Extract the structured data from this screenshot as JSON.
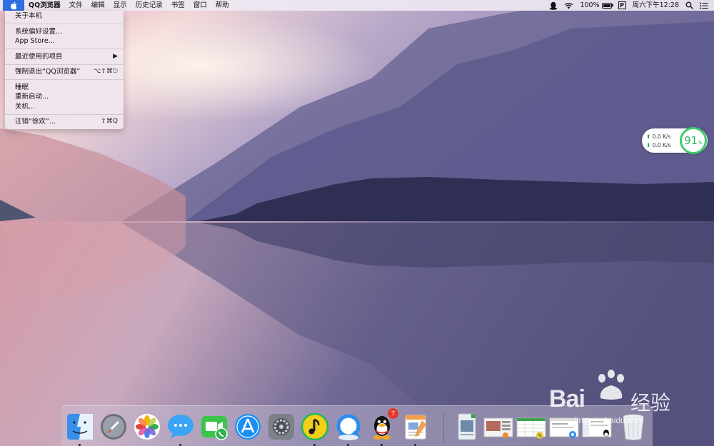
{
  "menubar": {
    "apple_icon": "apple-logo-icon",
    "app_name": "QQ浏览器",
    "menus": [
      "文件",
      "编辑",
      "显示",
      "历史记录",
      "书签",
      "窗口",
      "帮助"
    ],
    "status": {
      "battery_percent": "100%",
      "battery_level": 1.0,
      "input_method": "P",
      "datetime": "周六下午12:28"
    }
  },
  "apple_menu": {
    "groups": [
      [
        {
          "label": "关于本机",
          "shortcut": ""
        }
      ],
      [
        {
          "label": "系统偏好设置...",
          "shortcut": ""
        },
        {
          "label": "App Store...",
          "shortcut": ""
        }
      ],
      [
        {
          "label": "最近使用的项目",
          "shortcut": "▶"
        }
      ],
      [
        {
          "label": "强制退出“QQ浏览器”",
          "shortcut": "⌥⇧⌘⎋"
        }
      ],
      [
        {
          "label": "睡眠",
          "shortcut": ""
        },
        {
          "label": "重新启动...",
          "shortcut": ""
        },
        {
          "label": "关机...",
          "shortcut": ""
        }
      ],
      [
        {
          "label": "注销“徐欢”...",
          "shortcut": "⇧⌘Q"
        }
      ]
    ]
  },
  "net_widget": {
    "upload": "0.0 K/s",
    "download": "0.0 K/s",
    "percent": "91",
    "percent_unit": "%"
  },
  "dock": {
    "apps": [
      {
        "name": "finder-icon",
        "running": true
      },
      {
        "name": "launchpad-icon",
        "running": false
      },
      {
        "name": "photos-icon",
        "running": false
      },
      {
        "name": "messages-icon",
        "running": true
      },
      {
        "name": "facetime-icon",
        "running": false
      },
      {
        "name": "app-store-icon",
        "running": false
      },
      {
        "name": "system-preferences-icon",
        "running": false
      },
      {
        "name": "qq-music-icon",
        "running": true
      },
      {
        "name": "qq-browser-icon",
        "running": true
      },
      {
        "name": "qq-icon",
        "running": true,
        "badge": "7"
      },
      {
        "name": "pages-icon",
        "running": true
      }
    ],
    "docs": [
      {
        "name": "preview-document-icon"
      },
      {
        "name": "screenshot-thumbnail-icon"
      },
      {
        "name": "spreadsheet-thumbnail-icon"
      },
      {
        "name": "browser-thumbnail-icon"
      },
      {
        "name": "qq-thumbnail-icon"
      },
      {
        "name": "trash-icon"
      }
    ]
  },
  "watermark": {
    "brand": "Bai",
    "brand_cn": "经验",
    "url": "jingyan.baidu.com"
  }
}
